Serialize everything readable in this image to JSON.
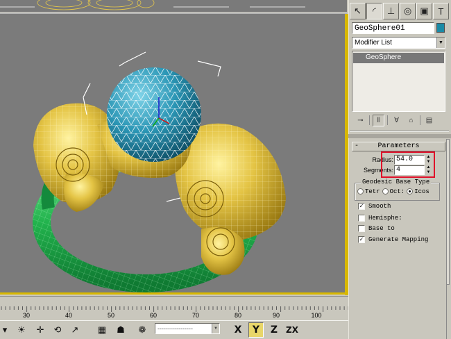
{
  "command_panel": {
    "tabs": [
      {
        "icon": "create-cursor-icon"
      },
      {
        "icon": "modify-arc-icon"
      },
      {
        "icon": "hierarchy-icon"
      },
      {
        "icon": "motion-icon"
      },
      {
        "icon": "display-icon"
      },
      {
        "icon": "utilities-hammer-icon"
      }
    ],
    "object_name": "GeoSphere01",
    "object_color": "#1a8aa5",
    "modifier_list_label": "Modifier List",
    "modifier_stack": [
      "GeoSphere"
    ],
    "parameters": {
      "title": "Parameters",
      "collapse_glyph": "-",
      "radius_label": "Radius:",
      "radius_value": "54.0",
      "segments_label": "Segments:",
      "segments_value": "4",
      "geodesic_title": "Geodesic Base Type",
      "base_types": [
        {
          "label": "Tetr",
          "checked": false
        },
        {
          "label": "Oct:",
          "checked": false
        },
        {
          "label": "Icos",
          "checked": true
        }
      ],
      "options": [
        {
          "label": "Smooth",
          "checked": true
        },
        {
          "label": "Hemisphe:",
          "checked": false
        },
        {
          "label": "Base to",
          "checked": false
        },
        {
          "label": "Generate Mapping",
          "checked": true
        }
      ]
    },
    "highlight_color": "#e0102a"
  },
  "trackbar": {
    "ticks": [
      "30",
      "40",
      "50",
      "60",
      "70",
      "80",
      "90",
      "100"
    ]
  },
  "bottom_toolbar": {
    "axis_buttons": [
      {
        "label": "X",
        "active": false
      },
      {
        "label": "Y",
        "active": true
      },
      {
        "label": "Z",
        "active": false
      },
      {
        "label": "ZX",
        "active": false
      }
    ],
    "selection_set_placeholder": "-----------------"
  },
  "colors": {
    "viewport_bg": "#7b7b7b",
    "viewport_border": "#d8b800",
    "ring_gold": "#e0c040",
    "ring_green": "#2dbb5a",
    "sphere_teal": "#1f8aa8"
  }
}
